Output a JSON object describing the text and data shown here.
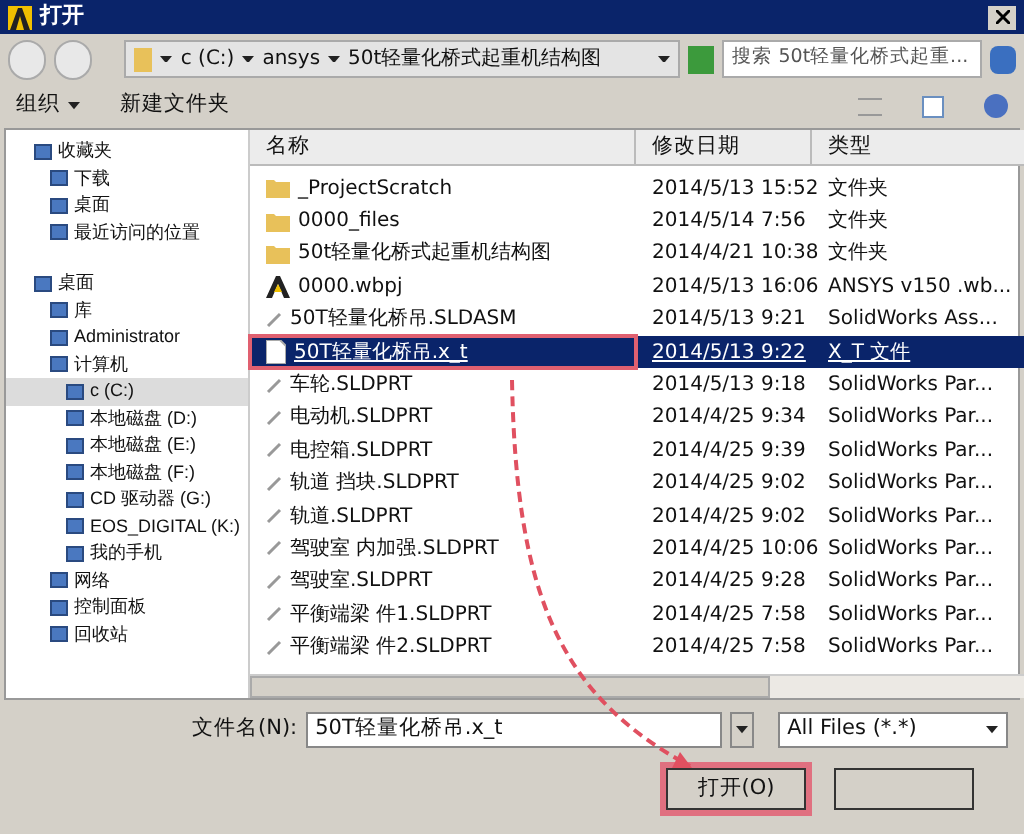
{
  "window": {
    "title": "打开"
  },
  "address": {
    "crumbs": [
      "c (C:)",
      "ansys",
      "50t轻量化桥式起重机结构图"
    ]
  },
  "search": {
    "placeholder": "搜索 50t轻量化桥式起重..."
  },
  "toolbar": {
    "organize": "组织",
    "new_folder": "新建文件夹"
  },
  "sidebar": {
    "items": [
      {
        "label": "收藏夹",
        "selected": false,
        "children": [
          {
            "label": "下载",
            "selected": false
          },
          {
            "label": "桌面",
            "selected": false
          },
          {
            "label": "最近访问的位置",
            "selected": false
          }
        ]
      },
      {
        "label": "桌面",
        "selected": false,
        "children": [
          {
            "label": "库",
            "selected": false
          },
          {
            "label": "Administrator",
            "selected": false
          },
          {
            "label": "计算机",
            "selected": false,
            "children": [
              {
                "label": "c (C:)",
                "selected": true
              },
              {
                "label": "本地磁盘 (D:)",
                "selected": false
              },
              {
                "label": "本地磁盘 (E:)",
                "selected": false
              },
              {
                "label": "本地磁盘 (F:)",
                "selected": false
              },
              {
                "label": "CD 驱动器 (G:)",
                "selected": false
              },
              {
                "label": "EOS_DIGITAL (K:)",
                "selected": false
              },
              {
                "label": "我的手机",
                "selected": false
              }
            ]
          },
          {
            "label": "网络",
            "selected": false
          },
          {
            "label": "控制面板",
            "selected": false
          },
          {
            "label": "回收站",
            "selected": false
          }
        ]
      }
    ]
  },
  "table": {
    "columns": [
      "名称",
      "修改日期",
      "类型"
    ],
    "rows": [
      {
        "kind": "folder",
        "name": "_ProjectScratch",
        "date": "2014/5/13 15:52",
        "type": "文件夹",
        "selected": false,
        "highlighted": false
      },
      {
        "kind": "folder",
        "name": "0000_files",
        "date": "2014/5/14 7:56",
        "type": "文件夹",
        "selected": false,
        "highlighted": false
      },
      {
        "kind": "folder",
        "name": "50t轻量化桥式起重机结构图",
        "date": "2014/4/21 10:38",
        "type": "文件夹",
        "selected": false,
        "highlighted": false
      },
      {
        "kind": "project",
        "name": "0000.wbpj",
        "date": "2014/5/13 16:06",
        "type": "ANSYS v150 .wb...",
        "selected": false,
        "highlighted": false
      },
      {
        "kind": "part",
        "name": "50T轻量化桥吊.SLDASM",
        "date": "2014/5/13 9:21",
        "type": "SolidWorks Ass...",
        "selected": false,
        "highlighted": false
      },
      {
        "kind": "file",
        "name": "50T轻量化桥吊.x_t",
        "date": "2014/5/13 9:22",
        "type": "X_T 文件",
        "selected": true,
        "highlighted": true
      },
      {
        "kind": "part",
        "name": "车轮.SLDPRT",
        "date": "2014/5/13 9:18",
        "type": "SolidWorks Par...",
        "selected": false,
        "highlighted": false
      },
      {
        "kind": "part",
        "name": "电动机.SLDPRT",
        "date": "2014/4/25 9:34",
        "type": "SolidWorks Par...",
        "selected": false,
        "highlighted": false
      },
      {
        "kind": "part",
        "name": "电控箱.SLDPRT",
        "date": "2014/4/25 9:39",
        "type": "SolidWorks Par...",
        "selected": false,
        "highlighted": false
      },
      {
        "kind": "part",
        "name": "轨道 挡块.SLDPRT",
        "date": "2014/4/25 9:02",
        "type": "SolidWorks Par...",
        "selected": false,
        "highlighted": false
      },
      {
        "kind": "part",
        "name": "轨道.SLDPRT",
        "date": "2014/4/25 9:02",
        "type": "SolidWorks Par...",
        "selected": false,
        "highlighted": false
      },
      {
        "kind": "part",
        "name": "驾驶室  内加强.SLDPRT",
        "date": "2014/4/25 10:06",
        "type": "SolidWorks Par...",
        "selected": false,
        "highlighted": false
      },
      {
        "kind": "part",
        "name": "驾驶室.SLDPRT",
        "date": "2014/4/25 9:28",
        "type": "SolidWorks Par...",
        "selected": false,
        "highlighted": false
      },
      {
        "kind": "part",
        "name": "平衡端梁  件1.SLDPRT",
        "date": "2014/4/25 7:58",
        "type": "SolidWorks Par...",
        "selected": false,
        "highlighted": false
      },
      {
        "kind": "part",
        "name": "平衡端梁  件2.SLDPRT",
        "date": "2014/4/25 7:58",
        "type": "SolidWorks Par...",
        "selected": false,
        "highlighted": false
      }
    ]
  },
  "filename": {
    "label": "文件名(N):",
    "value": "50T轻量化桥吊.x_t"
  },
  "filter": {
    "value": "All Files (*.*)"
  },
  "buttons": [
    {
      "label": "打开(O)",
      "highlighted": true
    },
    {
      "highlighted": false
    }
  ]
}
